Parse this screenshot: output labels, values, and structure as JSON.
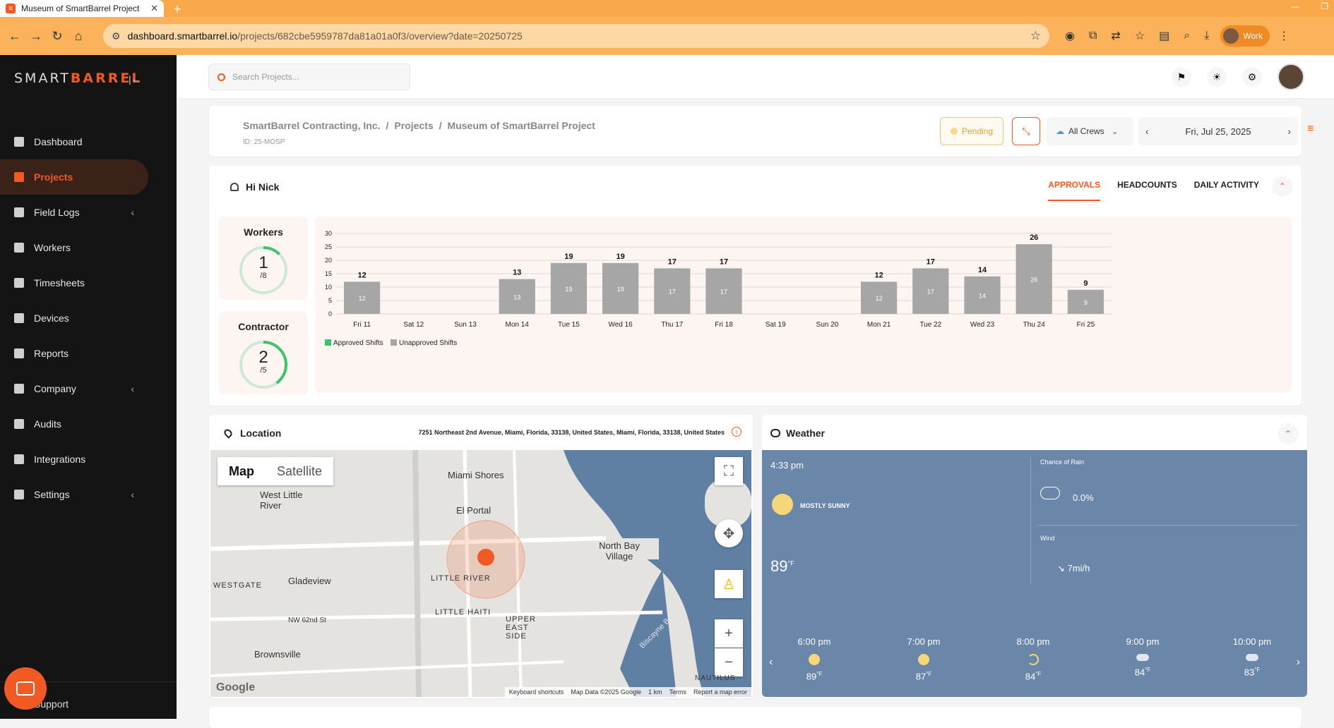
{
  "browser": {
    "tab_title": "Museum of SmartBarrel Project",
    "url_domain": "dashboard.smartbarrel.io",
    "url_path": "/projects/682cbe5959787da81a01a0f3/overview?date=20250725",
    "profile": "Work"
  },
  "sidebar": {
    "logo_left": "SMART",
    "logo_right": "BARREL",
    "items": [
      {
        "label": "Dashboard"
      },
      {
        "label": "Projects"
      },
      {
        "label": "Field Logs"
      },
      {
        "label": "Workers"
      },
      {
        "label": "Timesheets"
      },
      {
        "label": "Devices"
      },
      {
        "label": "Reports"
      },
      {
        "label": "Company"
      },
      {
        "label": "Audits"
      },
      {
        "label": "Integrations"
      },
      {
        "label": "Settings"
      }
    ],
    "support": "Support"
  },
  "header": {
    "search_placeholder": "Search Projects..."
  },
  "project": {
    "crumb_company": "SmartBarrel Contracting, Inc.",
    "crumb_projects": "Projects",
    "crumb_name": "Museum of SmartBarrel Project",
    "id": "ID: 25-MOSP",
    "status": "Pending",
    "crews": "All Crews",
    "date": "Fri, Jul 25, 2025"
  },
  "overview": {
    "greeting": "Hi Nick",
    "tabs": [
      "APPROVALS",
      "HEADCOUNTS",
      "DAILY ACTIVITY"
    ],
    "workers": {
      "label": "Workers",
      "value": "1",
      "total": "/8",
      "fraction": 0.125
    },
    "contractor": {
      "label": "Contractor",
      "value": "2",
      "total": "/5",
      "fraction": 0.4
    }
  },
  "chart_data": {
    "type": "bar",
    "categories": [
      "Fri 11",
      "Sat 12",
      "Sun 13",
      "Mon 14",
      "Tue 15",
      "Wed 16",
      "Thu 17",
      "Fri 18",
      "Sat 19",
      "Sun 20",
      "Mon 21",
      "Tue 22",
      "Wed 23",
      "Thu 24",
      "Fri 25"
    ],
    "series": [
      {
        "name": "Approved Shifts",
        "values": [
          0,
          0,
          0,
          0,
          0,
          0,
          0,
          0,
          0,
          0,
          0,
          0,
          0,
          0,
          0
        ],
        "color": "#3cc46a"
      },
      {
        "name": "Unapproved Shifts",
        "values": [
          12,
          0,
          0,
          13,
          19,
          19,
          17,
          17,
          0,
          0,
          12,
          17,
          14,
          26,
          9
        ],
        "color": "#a6a6a6"
      }
    ],
    "yticks": [
      0,
      5,
      10,
      15,
      20,
      25,
      30
    ],
    "ylim": [
      0,
      30
    ],
    "legend": "bottom-left"
  },
  "location": {
    "title": "Location",
    "address": "7251 Northeast 2nd Avenue, Miami, Florida, 33138, United States, Miami, Florida, 33138, United States",
    "map_tab": "Map",
    "satellite_tab": "Satellite",
    "labels": [
      "Miami Shores",
      "West Little River",
      "El Portal",
      "North Bay Village",
      "Gladeview",
      "LITTLE RIVER",
      "WESTGATE",
      "LITTLE HAITI",
      "UPPER EAST SIDE",
      "Brownsville",
      "Biscayne Bay",
      "NW 62nd St",
      "NAUTILUS"
    ],
    "footer": [
      "Keyboard shortcuts",
      "Map Data ©2025 Google",
      "1 km",
      "Terms",
      "Report a map error"
    ],
    "google": "Google"
  },
  "weather": {
    "title": "Weather",
    "time": "4:33 pm",
    "condition": "MOSTLY SUNNY",
    "temp": "89",
    "unit": "°F",
    "rain_label": "Chance of Rain",
    "rain_value": "0.0%",
    "wind_label": "Wind",
    "wind_value": "7mi/h",
    "hourly": [
      {
        "time": "6:00 pm",
        "temp": "89",
        "icon": "sun-icon"
      },
      {
        "time": "7:00 pm",
        "temp": "87",
        "icon": "sun-icon"
      },
      {
        "time": "8:00 pm",
        "temp": "84",
        "icon": "moon-icon"
      },
      {
        "time": "9:00 pm",
        "temp": "84",
        "icon": "cloud-moon-icon"
      },
      {
        "time": "10:00 pm",
        "temp": "83",
        "icon": "cloud-moon-icon"
      }
    ]
  }
}
